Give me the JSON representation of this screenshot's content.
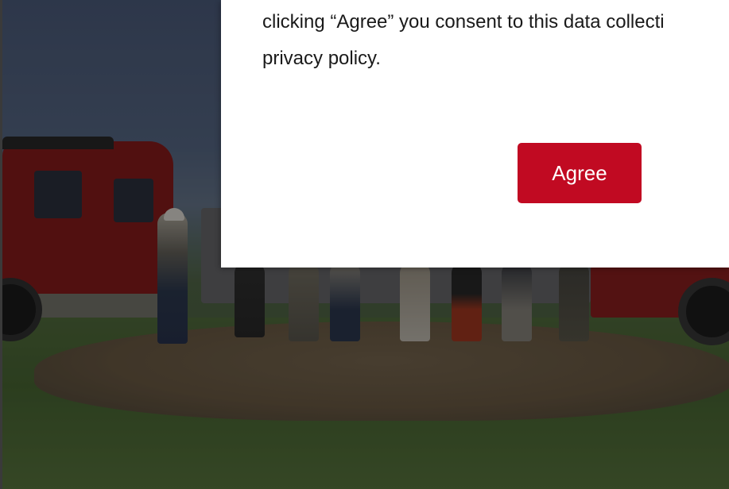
{
  "consent_modal": {
    "text": "clicking “Agree” you consent to this data collecti\nprivacy policy.",
    "agree_label": "Agree",
    "accent_color": "#c10a22"
  },
  "background": {
    "image": "groundbreaking-ceremony-photo"
  }
}
